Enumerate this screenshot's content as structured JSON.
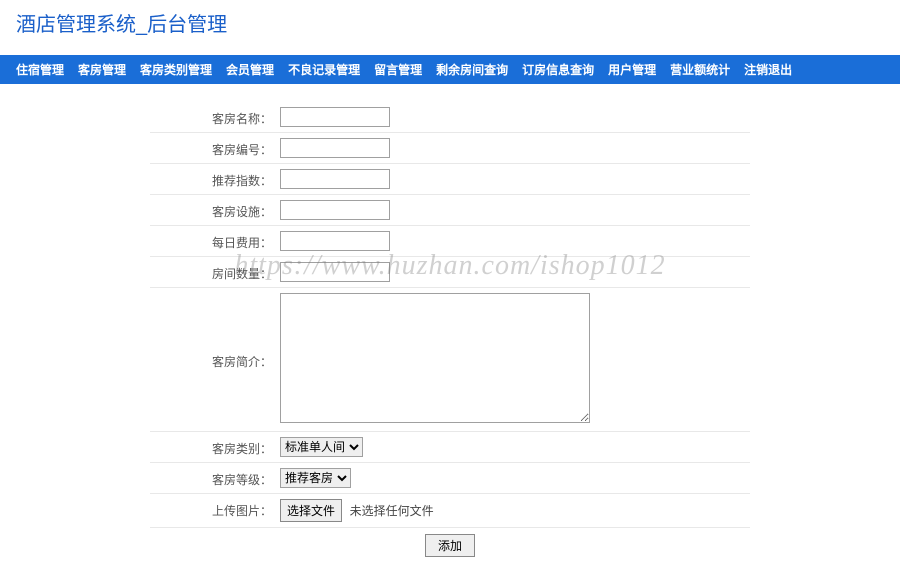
{
  "title": "酒店管理系统_后台管理",
  "nav": [
    "住宿管理",
    "客房管理",
    "客房类别管理",
    "会员管理",
    "不良记录管理",
    "留言管理",
    "剩余房间查询",
    "订房信息查询",
    "用户管理",
    "营业额统计",
    "注销退出"
  ],
  "form": {
    "room_name": {
      "label": "客房名称：",
      "value": ""
    },
    "room_no": {
      "label": "客房编号：",
      "value": ""
    },
    "rec_index": {
      "label": "推荐指数：",
      "value": ""
    },
    "facility": {
      "label": "客房设施：",
      "value": ""
    },
    "day_cost": {
      "label": "每日费用：",
      "value": ""
    },
    "quantity": {
      "label": "房间数量：",
      "value": ""
    },
    "intro": {
      "label": "客房简介：",
      "value": ""
    },
    "category": {
      "label": "客房类别：",
      "selected": "标准单人间"
    },
    "level": {
      "label": "客房等级：",
      "selected": "推荐客房"
    },
    "upload": {
      "label": "上传图片：",
      "button": "选择文件",
      "status": "未选择任何文件"
    },
    "submit": "添加"
  },
  "watermark": "https://www.huzhan.com/ishop1012"
}
